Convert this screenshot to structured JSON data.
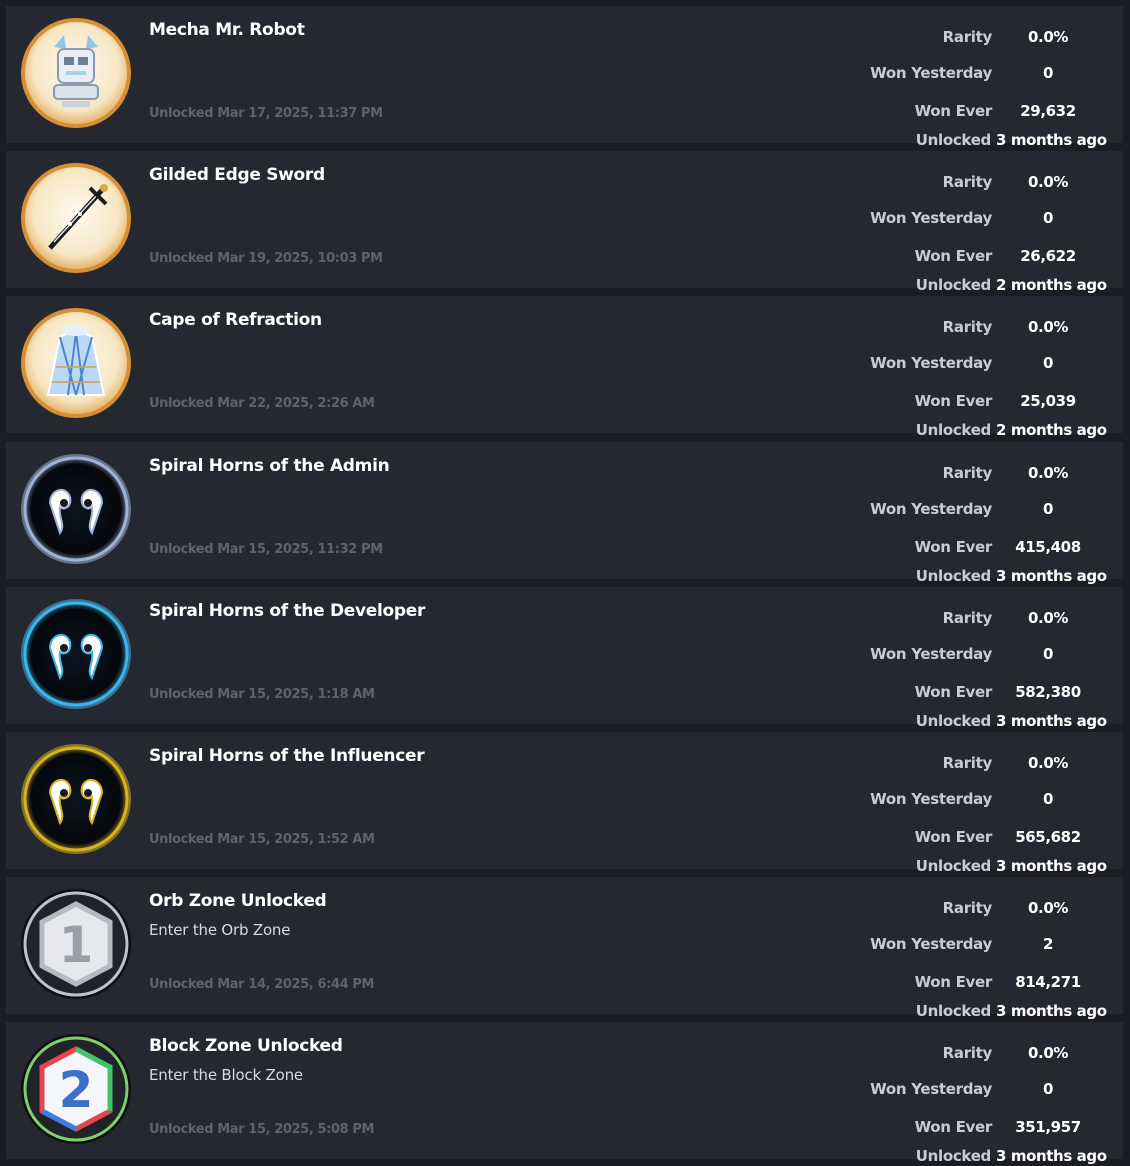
{
  "labels": {
    "rarity": "Rarity",
    "won_yesterday": "Won Yesterday",
    "won_ever": "Won Ever",
    "unlocked": "Unlocked"
  },
  "badges": [
    {
      "title": "Mecha Mr. Robot",
      "description": "",
      "date": "Unlocked Mar 17, 2025, 11:37 PM",
      "rarity": "0.0%",
      "won_yesterday": "0",
      "won_ever": "29,632",
      "unlocked_ago": "3 months ago",
      "icon": "mecha-robot-icon",
      "ring_color": "#e9b566"
    },
    {
      "title": "Gilded Edge Sword",
      "description": "",
      "date": "Unlocked Mar 19, 2025, 10:03 PM",
      "rarity": "0.0%",
      "won_yesterday": "0",
      "won_ever": "26,622",
      "unlocked_ago": "2 months ago",
      "icon": "sword-icon",
      "ring_color": "#e9b566"
    },
    {
      "title": "Cape of Refraction",
      "description": "",
      "date": "Unlocked Mar 22, 2025, 2:26 AM",
      "rarity": "0.0%",
      "won_yesterday": "0",
      "won_ever": "25,039",
      "unlocked_ago": "2 months ago",
      "icon": "cape-icon",
      "ring_color": "#e9b566"
    },
    {
      "title": "Spiral Horns of the Admin",
      "description": "",
      "date": "Unlocked Mar 15, 2025, 11:32 PM",
      "rarity": "0.0%",
      "won_yesterday": "0",
      "won_ever": "415,408",
      "unlocked_ago": "3 months ago",
      "icon": "horns-icon",
      "ring_color": "#9fb3d6"
    },
    {
      "title": "Spiral Horns of the Developer",
      "description": "",
      "date": "Unlocked Mar 15, 2025, 1:18 AM",
      "rarity": "0.0%",
      "won_yesterday": "0",
      "won_ever": "582,380",
      "unlocked_ago": "3 months ago",
      "icon": "horns-icon",
      "ring_color": "#3fb4e8"
    },
    {
      "title": "Spiral Horns of the Influencer",
      "description": "",
      "date": "Unlocked Mar 15, 2025, 1:52 AM",
      "rarity": "0.0%",
      "won_yesterday": "0",
      "won_ever": "565,682",
      "unlocked_ago": "3 months ago",
      "icon": "horns-icon",
      "ring_color": "#d6b21f"
    },
    {
      "title": "Orb Zone Unlocked",
      "description": "Enter the Orb Zone",
      "date": "Unlocked Mar 14, 2025, 6:44 PM",
      "rarity": "0.0%",
      "won_yesterday": "2",
      "won_ever": "814,271",
      "unlocked_ago": "3 months ago",
      "icon": "zone-1-icon",
      "ring_color": "#bfc3c9",
      "numeral": "1"
    },
    {
      "title": "Block Zone Unlocked",
      "description": "Enter the Block Zone",
      "date": "Unlocked Mar 15, 2025, 5:08 PM",
      "rarity": "0.0%",
      "won_yesterday": "0",
      "won_ever": "351,957",
      "unlocked_ago": "3 months ago",
      "icon": "zone-2-icon",
      "ring_color": "#7fcf6a",
      "numeral": "2"
    }
  ]
}
